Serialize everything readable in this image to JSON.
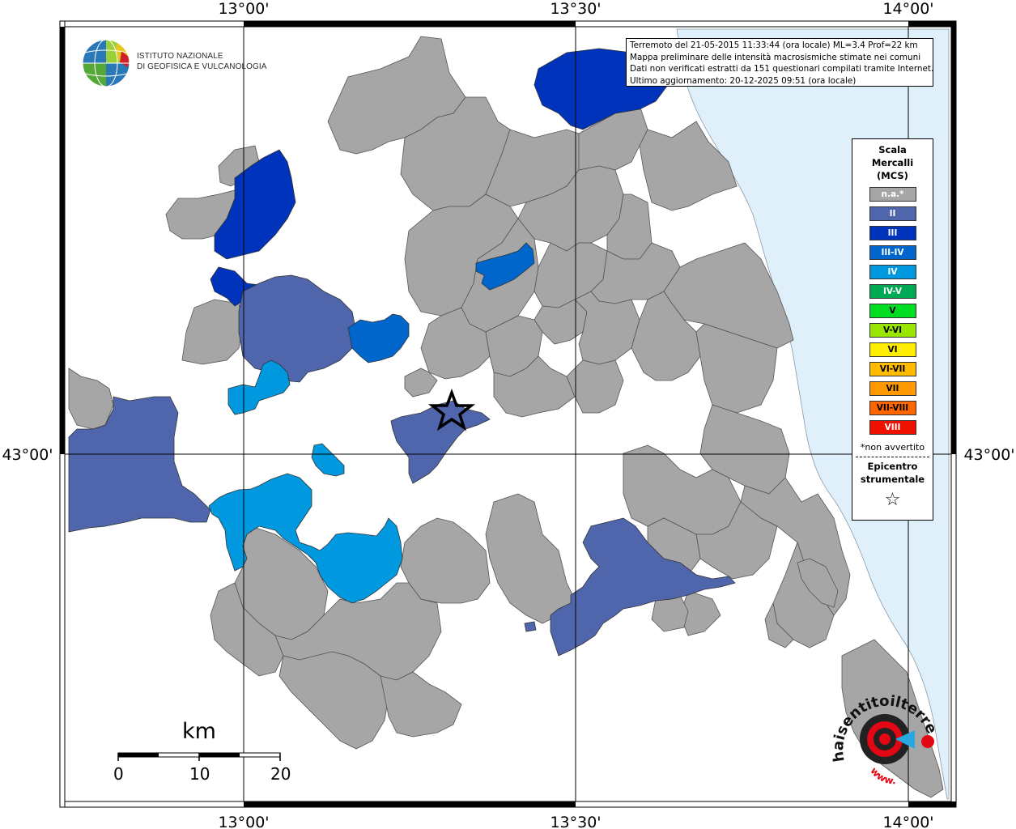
{
  "info": {
    "line1": "Terremoto del 21-05-2015 11:33:44 (ora locale) ML=3.4 Prof=22 km",
    "line2": "Mappa preliminare delle intensità macrosismiche stimate nei comuni",
    "line3": "Dati non verificati estratti da 151 questionari compilati tramite Internet.",
    "line4": "Ultimo aggiornamento: 20-12-2025 09:51 (ora locale)"
  },
  "logo": {
    "line1": "ISTITUTO NAZIONALE",
    "line2": "DI GEOFISICA E VULCANOLOGIA"
  },
  "coordinates": {
    "top": [
      "13°00'",
      "13°30'",
      "14°00'"
    ],
    "bottom": [
      "13°00'",
      "13°30'",
      "14°00'"
    ],
    "left": "43°00'",
    "right": "43°00'"
  },
  "legend": {
    "title": "Scala\nMercalli\n(MCS)",
    "items": [
      {
        "label": "n.a.*",
        "color": "#a6a6a6",
        "text_color": "#ffffff"
      },
      {
        "label": "II",
        "color": "#4f66ad",
        "text_color": "#ffffff"
      },
      {
        "label": "III",
        "color": "#0033bb",
        "text_color": "#ffffff"
      },
      {
        "label": "III-IV",
        "color": "#0066cc",
        "text_color": "#ffffff"
      },
      {
        "label": "IV",
        "color": "#0099e0",
        "text_color": "#ffffff"
      },
      {
        "label": "IV-V",
        "color": "#00aa55",
        "text_color": "#ffffff"
      },
      {
        "label": "V",
        "color": "#00dd22",
        "text_color": "#000000"
      },
      {
        "label": "V-VI",
        "color": "#99e600",
        "text_color": "#000000"
      },
      {
        "label": "VI",
        "color": "#ffee00",
        "text_color": "#000000"
      },
      {
        "label": "VI-VII",
        "color": "#ffbb00",
        "text_color": "#000000"
      },
      {
        "label": "VII",
        "color": "#ff9900",
        "text_color": "#000000"
      },
      {
        "label": "VII-VIII",
        "color": "#ff6600",
        "text_color": "#000000"
      },
      {
        "label": "VIII",
        "color": "#ee1100",
        "text_color": "#ffffff"
      }
    ],
    "note": "*non avvertito",
    "epicenter_title": "Epicentro\nstrumentale",
    "epicenter_symbol": "☆"
  },
  "scale_bar": {
    "title": "km",
    "labels": [
      "0",
      "10",
      "20"
    ]
  },
  "watermark": {
    "text": "haisentitoilterremoto.it",
    "prefix": "www."
  },
  "colors": {
    "sea": "#e0f0fb",
    "na": "#a6a6a6"
  }
}
